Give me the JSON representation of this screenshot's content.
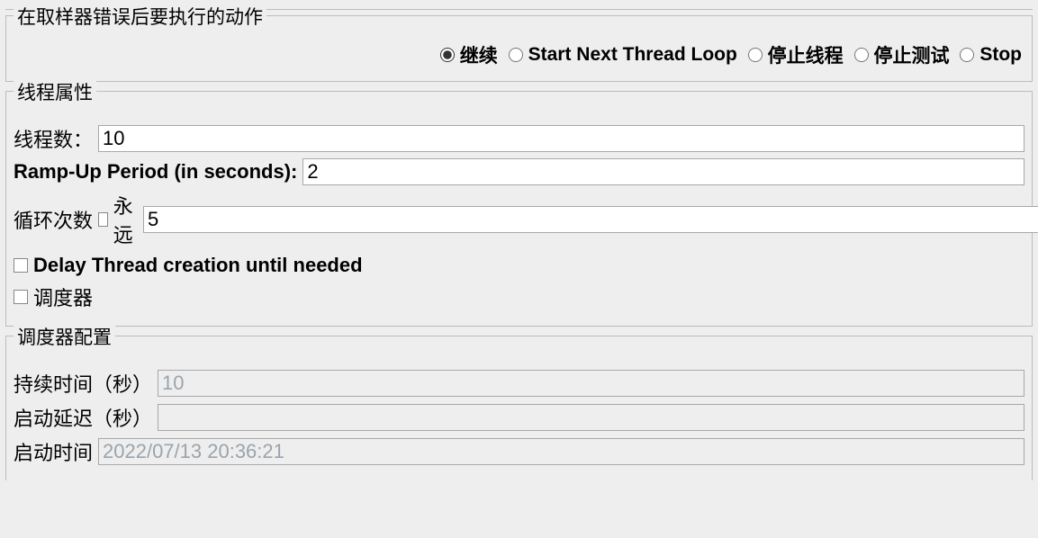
{
  "onError": {
    "legend": "在取样器错误后要执行的动作",
    "options": {
      "continue": "继续",
      "startNext": "Start Next Thread Loop",
      "stopThread": "停止线程",
      "stopTest": "停止测试",
      "stopTestNow": "Stop"
    },
    "selected": "continue"
  },
  "threadProps": {
    "legend": "线程属性",
    "numThreads": {
      "label": "线程数：",
      "value": "10"
    },
    "rampUp": {
      "label": "Ramp-Up Period (in seconds):",
      "value": "2"
    },
    "loopCount": {
      "label": "循环次数",
      "foreverLabel": "永远",
      "forever": false,
      "value": "5"
    },
    "delayThread": {
      "label": "Delay Thread creation until needed",
      "checked": false
    },
    "scheduler": {
      "label": "调度器",
      "checked": false
    }
  },
  "schedulerCfg": {
    "legend": "调度器配置",
    "duration": {
      "label": "持续时间（秒）",
      "value": "10"
    },
    "startupDelay": {
      "label": "启动延迟（秒）",
      "value": ""
    },
    "startTime": {
      "label": "启动时间",
      "value": "2022/07/13 20:36:21"
    }
  }
}
